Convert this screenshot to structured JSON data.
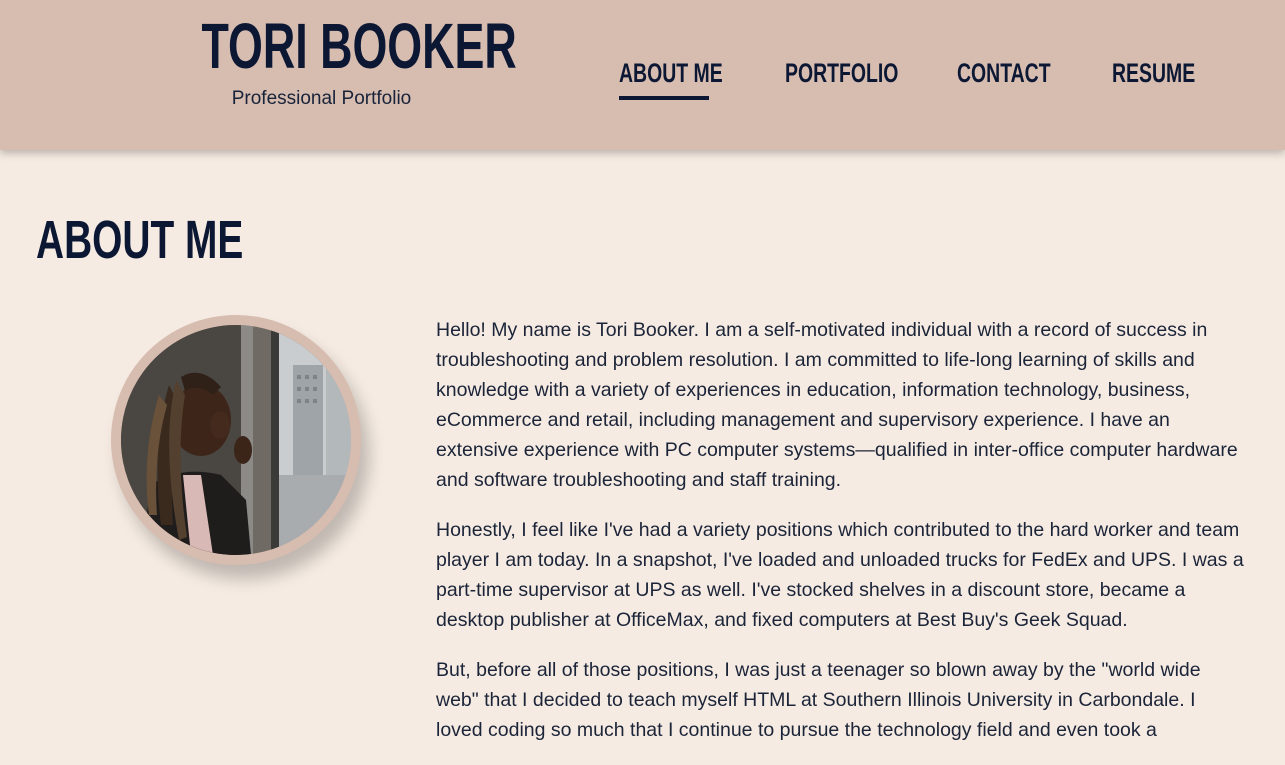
{
  "header": {
    "name": "TORI BOOKER",
    "tagline": "Professional Portfolio"
  },
  "nav": {
    "items": [
      {
        "label": "ABOUT ME",
        "active": true
      },
      {
        "label": "PORTFOLIO",
        "active": false
      },
      {
        "label": "CONTACT",
        "active": false
      },
      {
        "label": "RESUME",
        "active": false
      }
    ]
  },
  "main": {
    "title": "ABOUT ME",
    "paragraphs": [
      "Hello! My name is Tori Booker. I am a self-motivated individual with a record of success in troubleshooting and problem resolution. I am committed to life-long learning of skills and knowledge with a variety of experiences in education, information technology, business, eCommerce and retail, including management and supervisory experience. I have an extensive experience with PC computer systems—qualified in inter-office computer hardware and software troubleshooting and staff training.",
      "Honestly, I feel like I've had a variety positions which contributed to the hard worker and team player I am today. In a snapshot, I've loaded and unloaded trucks for FedEx and UPS. I was a part-time supervisor at UPS as well. I've stocked shelves in a discount store, became a desktop publisher at OfficeMax, and fixed computers at Best Buy's Geek Squad.",
      "But, before all of those positions, I was just a teenager so blown away by the \"world wide web\" that I decided to teach myself HTML at Southern Illinois University in Carbondale. I loved coding so much that I continue to pursue the technology field and even took a"
    ]
  },
  "colors": {
    "header_bg": "#d7bcb0",
    "page_bg": "#f5ebe2",
    "text_dark": "#0c1833"
  }
}
